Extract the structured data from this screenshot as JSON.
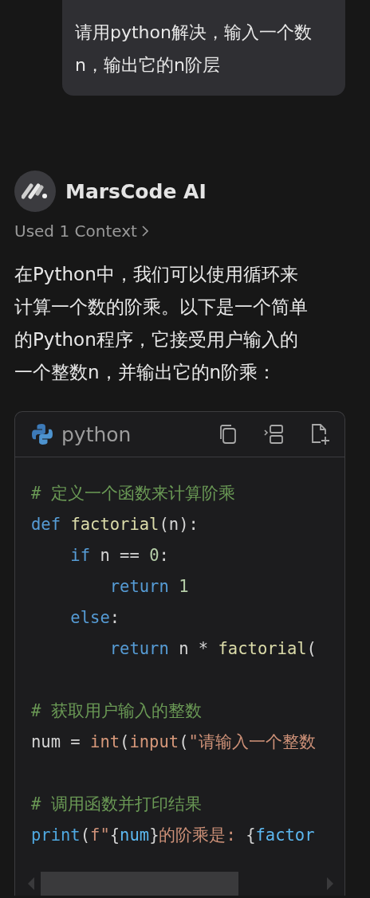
{
  "user_message": {
    "text": "请用python解决，输入一个数n，输出它的n阶层"
  },
  "assistant": {
    "name": "MarsCode AI",
    "context_link": "Used 1 Context",
    "paragraph": "在Python中，我们可以使用循环来计算一个数的阶乘。以下是一个简单的Python程序，它接受用户输入的一个整数n，并输出它的n阶乘："
  },
  "code_block": {
    "language": "python",
    "lines": [
      {
        "kind": "code",
        "tokens": [
          {
            "text": "# 定义一个函数来计算阶乘",
            "kind": "comment"
          }
        ]
      },
      {
        "kind": "code",
        "tokens": [
          {
            "text": "def ",
            "kind": "keyword"
          },
          {
            "text": "factorial",
            "kind": "function"
          },
          {
            "text": "(n):",
            "kind": "plain"
          }
        ]
      },
      {
        "kind": "code",
        "tokens": [
          {
            "text": "    if",
            "kind": "keyword"
          },
          {
            "text": " n == ",
            "kind": "plain"
          },
          {
            "text": "0",
            "kind": "number"
          },
          {
            "text": ":",
            "kind": "plain"
          }
        ]
      },
      {
        "kind": "code",
        "tokens": [
          {
            "text": "        return ",
            "kind": "keyword"
          },
          {
            "text": "1",
            "kind": "number"
          }
        ]
      },
      {
        "kind": "code",
        "tokens": [
          {
            "text": "    else",
            "kind": "keyword"
          },
          {
            "text": ":",
            "kind": "plain"
          }
        ]
      },
      {
        "kind": "code",
        "tokens": [
          {
            "text": "        return",
            "kind": "keyword"
          },
          {
            "text": " n * ",
            "kind": "plain"
          },
          {
            "text": "factorial",
            "kind": "function"
          },
          {
            "text": "(",
            "kind": "plain"
          }
        ]
      },
      {
        "kind": "blank"
      },
      {
        "kind": "code",
        "tokens": [
          {
            "text": "# 获取用户输入的整数",
            "kind": "comment"
          }
        ]
      },
      {
        "kind": "code",
        "tokens": [
          {
            "text": "num = ",
            "kind": "plain"
          },
          {
            "text": "int",
            "kind": "builtin"
          },
          {
            "text": "(",
            "kind": "plain"
          },
          {
            "text": "input",
            "kind": "builtin"
          },
          {
            "text": "(",
            "kind": "plain"
          },
          {
            "text": "\"请输入一个整数",
            "kind": "string"
          }
        ]
      },
      {
        "kind": "blank"
      },
      {
        "kind": "code",
        "tokens": [
          {
            "text": "# 调用函数并打印结果",
            "kind": "comment"
          }
        ]
      },
      {
        "kind": "code",
        "tokens": [
          {
            "text": "print",
            "kind": "call"
          },
          {
            "text": "(",
            "kind": "plain"
          },
          {
            "text": "f\"",
            "kind": "string"
          },
          {
            "text": "{",
            "kind": "plain"
          },
          {
            "text": "num",
            "kind": "variable"
          },
          {
            "text": "}",
            "kind": "plain"
          },
          {
            "text": "的阶乘是: ",
            "kind": "string"
          },
          {
            "text": "{",
            "kind": "plain"
          },
          {
            "text": "factor",
            "kind": "variable"
          }
        ]
      }
    ]
  }
}
